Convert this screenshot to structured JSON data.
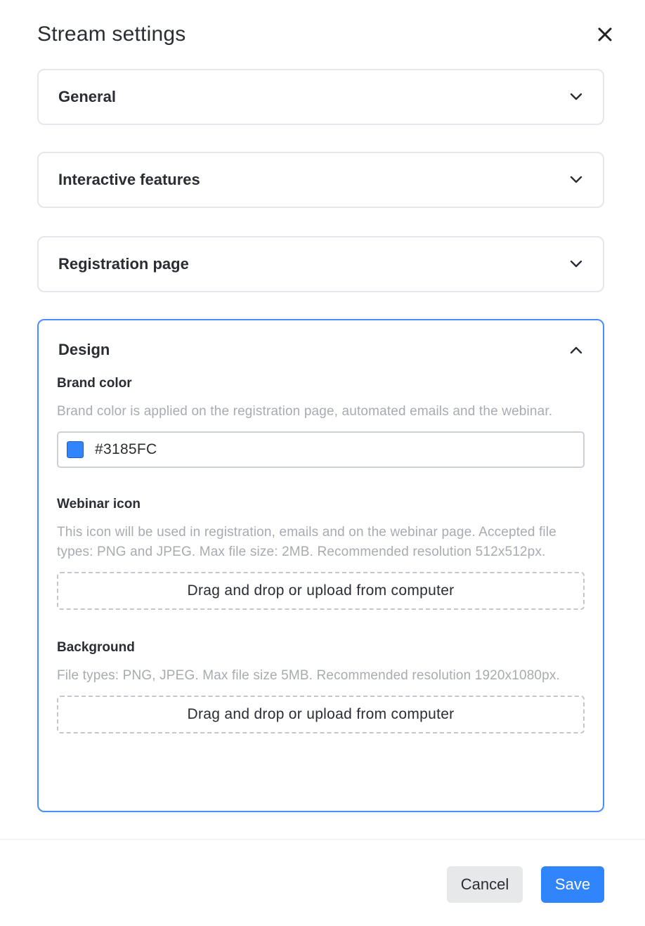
{
  "dialog": {
    "title": "Stream settings",
    "close_icon": "close-icon"
  },
  "panels": [
    {
      "title": "General",
      "state": "collapsed",
      "icon": "chevron-down-icon"
    },
    {
      "title": "Interactive features",
      "state": "collapsed",
      "icon": "chevron-down-icon"
    },
    {
      "title": "Registration page",
      "state": "collapsed",
      "icon": "chevron-down-icon"
    },
    {
      "title": "Design",
      "state": "expanded",
      "icon": "chevron-up-icon"
    }
  ],
  "design": {
    "brand_color": {
      "label": "Brand color",
      "help": "Brand color is applied on the registration page, automated emails and the webinar.",
      "value": "#3185FC",
      "swatch_color": "#3185FC"
    },
    "webinar_icon": {
      "label": "Webinar icon",
      "help": "This icon will be used in registration, emails and on the webinar page. Accepted file types: PNG and JPEG. Max file size: 2MB. Recommended resolution 512x512px.",
      "dropzone_label": "Drag and drop or upload from computer"
    },
    "background": {
      "label": "Background",
      "help": "File types: PNG, JPEG. Max file size 5MB. Recommended resolution 1920x1080px.",
      "dropzone_label": "Drag and drop or upload from computer"
    }
  },
  "footer": {
    "cancel_label": "Cancel",
    "save_label": "Save"
  },
  "colors": {
    "accent": "#3185FC",
    "panel_border": "#E6E7EA",
    "active_border": "#4A8EF7",
    "muted_text": "#A8ABB2"
  }
}
